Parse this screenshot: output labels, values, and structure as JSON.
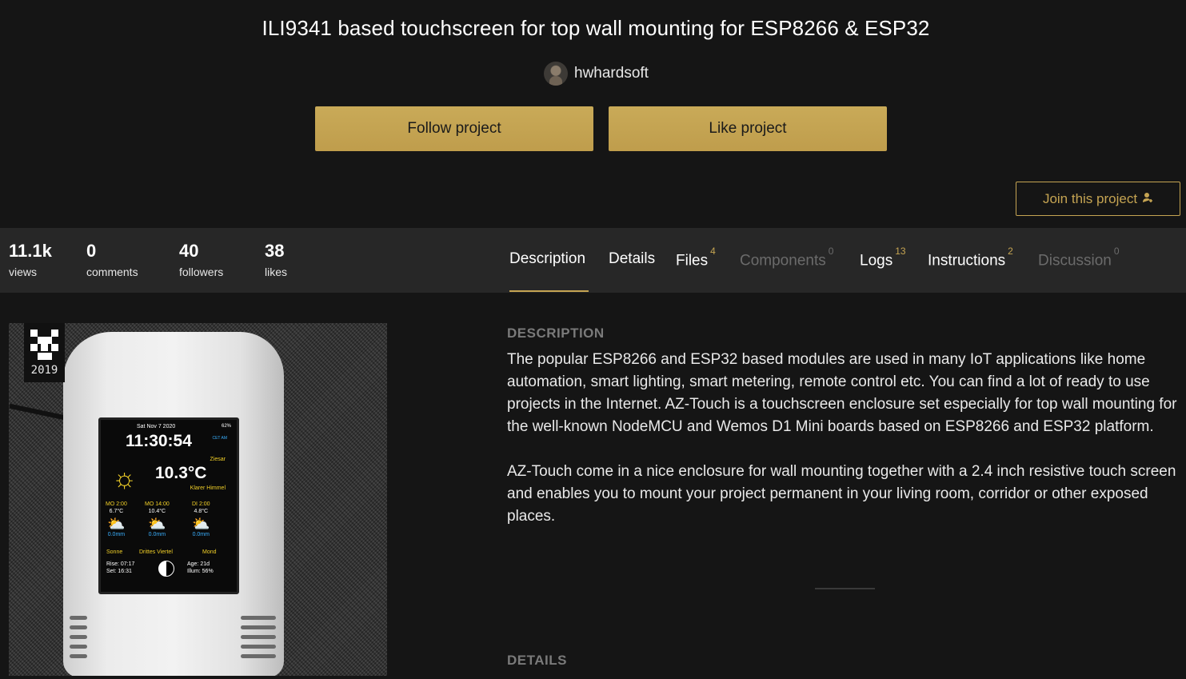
{
  "header": {
    "title": "ILI9341 based touchscreen for top wall mounting for ESP8266 & ESP32",
    "author": "hwhardsoft",
    "follow_label": "Follow project",
    "like_label": "Like project",
    "join_label": "Join this project"
  },
  "stats": [
    {
      "value": "11.1k",
      "label": "views"
    },
    {
      "value": "0",
      "label": "comments"
    },
    {
      "value": "40",
      "label": "followers"
    },
    {
      "value": "38",
      "label": "likes"
    }
  ],
  "tabs": [
    {
      "label": "Description",
      "count": "",
      "active": true,
      "enabled": true
    },
    {
      "label": "Details",
      "count": "",
      "active": false,
      "enabled": true
    },
    {
      "label": "Files",
      "count": "4",
      "active": false,
      "enabled": true
    },
    {
      "label": "Components",
      "count": "0",
      "active": false,
      "enabled": false
    },
    {
      "label": "Logs",
      "count": "13",
      "active": false,
      "enabled": true
    },
    {
      "label": "Instructions",
      "count": "2",
      "active": false,
      "enabled": true
    },
    {
      "label": "Discussion",
      "count": "0",
      "active": false,
      "enabled": false
    }
  ],
  "photo": {
    "badge_year": "2019",
    "screen": {
      "date": "Sat Nov 7 2020",
      "percent": "62%",
      "time": "11:30:54",
      "ampm": "CET AM",
      "city": "Ziesar",
      "temp": "10.3°C",
      "desc": "Klarer Himmel",
      "forecast": [
        {
          "day": "MO 2:00",
          "temp": "6.7°C",
          "rain": "0.0mm"
        },
        {
          "day": "MO 14:00",
          "temp": "10.4°C",
          "rain": "0.0mm"
        },
        {
          "day": "DI 2:00",
          "temp": "4.8°C",
          "rain": "0.0mm"
        }
      ],
      "sun_label": "Sonne",
      "phase_label": "Drittes Viertel",
      "moon_label": "Mond",
      "rise": "Rise: 07:17",
      "set": "Set: 16:31",
      "age": "Age: 21d",
      "illum": "Illum: 56%"
    }
  },
  "description": {
    "heading": "DESCRIPTION",
    "paragraph1": "The popular ESP8266 and ESP32 based modules are used in many IoT applications like home automation, smart lighting, smart metering, remote control etc. You can find a lot of ready to use projects in the Internet. AZ-Touch is a touchscreen enclosure set especially for top wall mounting for the well-known NodeMCU and Wemos D1 Mini boards based on ESP8266 and ESP32 platform.",
    "paragraph2": "AZ-Touch come in a nice enclosure for wall mounting together with a 2.4 inch resistive touch screen and enables you to mount your project permanent in your living room, corridor or other exposed places."
  },
  "details": {
    "heading": "DETAILS"
  },
  "colors": {
    "accent": "#c5a452",
    "background": "#151515",
    "bar": "#272727",
    "muted": "#7a7a7a"
  }
}
